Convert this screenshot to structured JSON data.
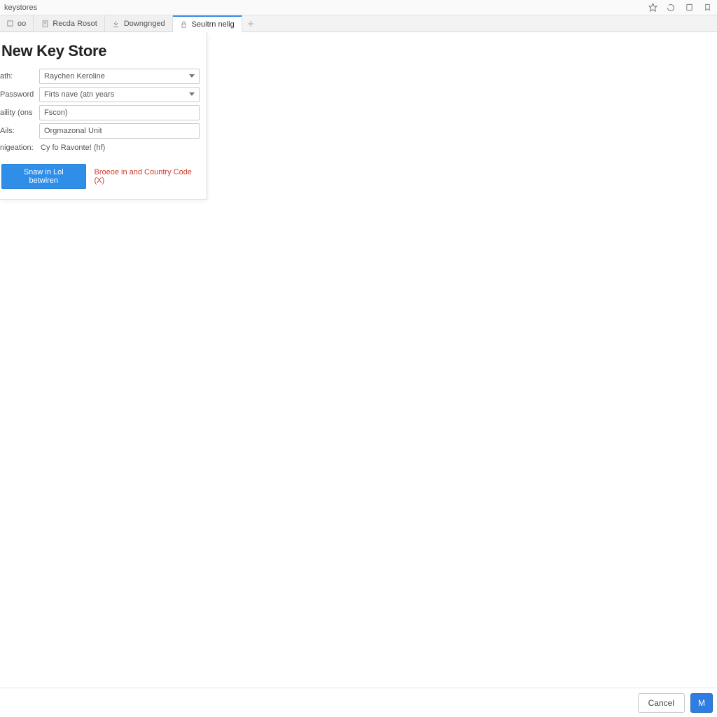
{
  "addrbar": {
    "title": "keystores"
  },
  "tabs": [
    {
      "icon": "square-icon",
      "label": "oo"
    },
    {
      "icon": "doc-icon",
      "label": "Recda Rosot"
    },
    {
      "icon": "download-icon",
      "label": "Downgnged"
    },
    {
      "icon": "lock-icon",
      "label": "Seuitrn nelig"
    }
  ],
  "dialog": {
    "title": "New Key Store",
    "rows": {
      "path": {
        "label": "ath:",
        "value": "Raychen Keroline"
      },
      "password": {
        "label": "Password",
        "value": "Firts nave (atn years"
      },
      "validity": {
        "label": "aility (ons",
        "value": "Fscon)"
      },
      "alias": {
        "label": "Ails:",
        "value": "Orgmazonal Unit"
      },
      "description": {
        "label": "nigeation:",
        "value": "Cy fo Ravonte! (hf)"
      }
    },
    "actions": {
      "primary": "Snaw in Lol betwiren",
      "secondary": "Broeoe in and Country Code (X)"
    }
  },
  "bottom": {
    "cancel": "Cancel",
    "ok": "M"
  }
}
